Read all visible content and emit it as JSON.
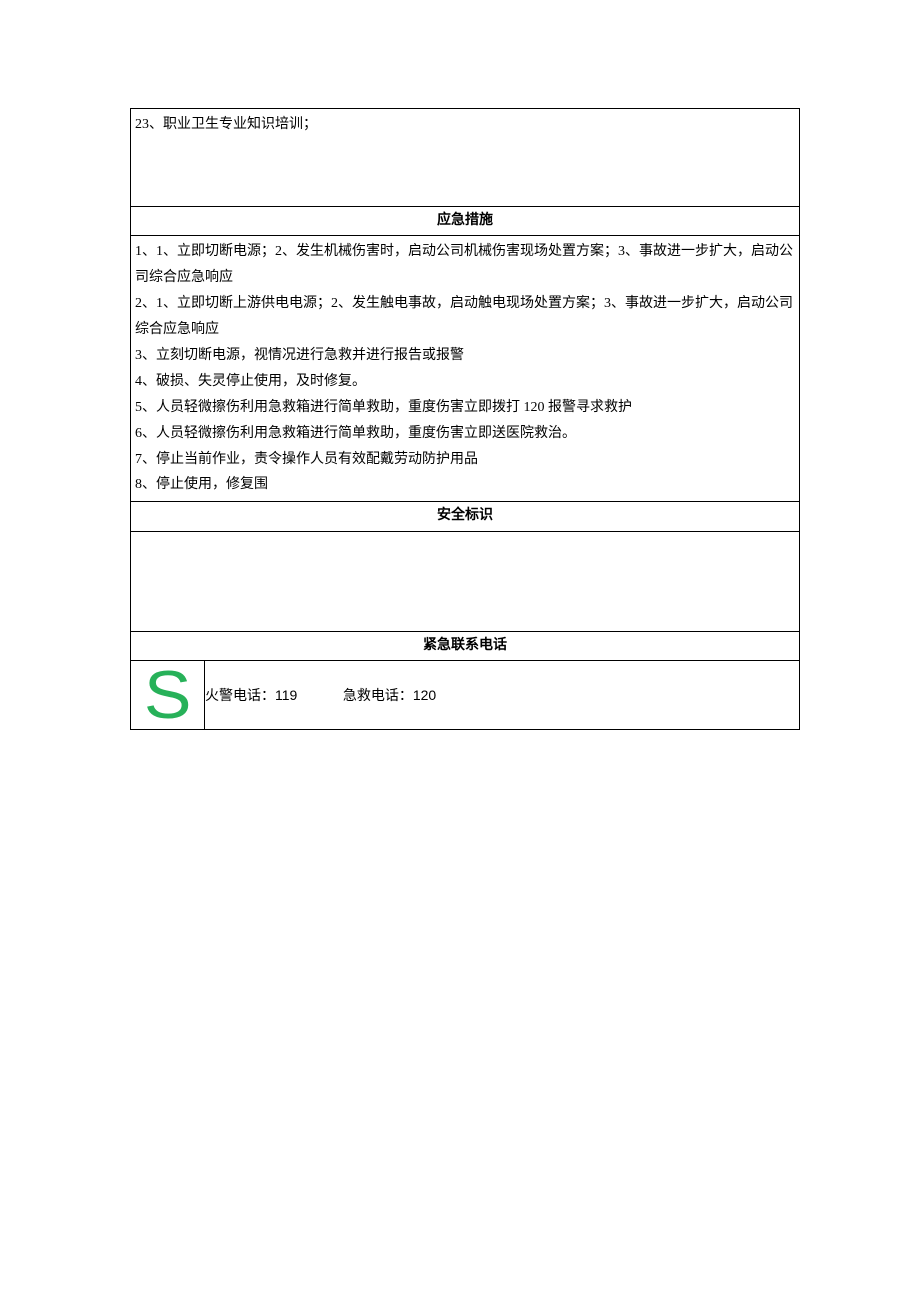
{
  "top_item": "23、职业卫生专业知识培训；",
  "sections": {
    "emergency_measures_header": "应急措施",
    "safety_sign_header": "安全标识",
    "emergency_contact_header": "紧急联系电话"
  },
  "emergency_measures": [
    "1、1、立即切断电源；2、发生机械伤害时，启动公司机械伤害现场处置方案；3、事故进一步扩大，启动公司综合应急响应",
    "2、1、立即切断上游供电电源；2、发生触电事故，启动触电现场处置方案；3、事故进一步扩大，启动公司综合应急响应",
    "3、立刻切断电源，视情况进行急救并进行报告或报警",
    "4、破损、失灵停止使用，及时修复。",
    "5、人员轻微擦伤利用急救箱进行简单救助，重度伤害立即拨打 120 报警寻求救护",
    "6、人员轻微擦伤利用急救箱进行简单救助，重度伤害立即送医院救治。",
    "7、停止当前作业，责令操作人员有效配戴劳动防护用品",
    "8、停止使用，修复围"
  ],
  "contacts": {
    "fire_label": "火警电话：",
    "fire_number": "119",
    "ambulance_label": "急救电话：",
    "ambulance_number": "120"
  },
  "s_icon_glyph": "S"
}
